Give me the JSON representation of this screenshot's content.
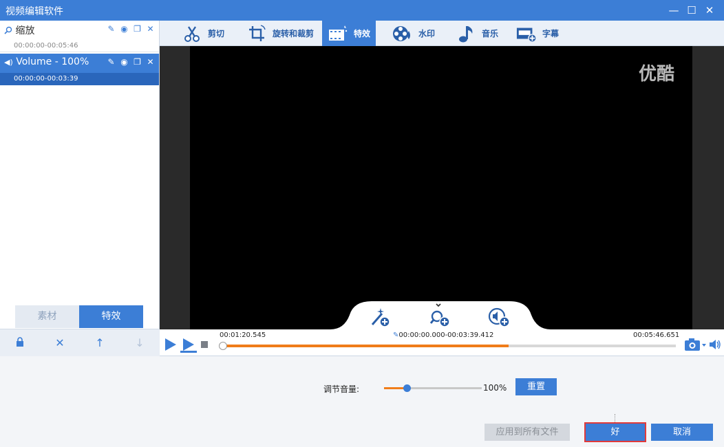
{
  "window": {
    "title": "视频编辑软件",
    "minimize_glyph": "—",
    "maximize_glyph": "☐",
    "close_glyph": "✕"
  },
  "layers": [
    {
      "name": "缩放",
      "time": "00:00:00-00:05:46",
      "selected": false
    },
    {
      "name": "Volume - 100%",
      "time": "00:00:00-00:03:39",
      "selected": true
    }
  ],
  "left_tabs": {
    "material": "素材",
    "effects": "特效",
    "active": "effects"
  },
  "toolbar_tabs": [
    {
      "label": "剪切",
      "icon": "cut-icon"
    },
    {
      "label": "旋转和裁剪",
      "icon": "crop-rotate-icon"
    },
    {
      "label": "特效",
      "icon": "effects-icon",
      "active": true
    },
    {
      "label": "水印",
      "icon": "watermark-icon"
    },
    {
      "label": "音乐",
      "icon": "music-note-icon"
    },
    {
      "label": "字幕",
      "icon": "subtitle-icon"
    }
  ],
  "video": {
    "watermark": "优酷"
  },
  "timeline": {
    "current_time": "00:01:20.545",
    "range": "00:00:00.000-00:03:39.412",
    "total_time": "00:05:46.651",
    "progress_fill": 0.63,
    "handle_pos": 0.0
  },
  "volume": {
    "label": "调节音量:",
    "value_text": "100%",
    "level": 0.23
  },
  "buttons": {
    "reset": "重置",
    "apply_all": "应用到所有文件",
    "ok": "好",
    "cancel": "取消"
  },
  "colors": {
    "accent": "#3c7ed6",
    "progress": "#f07d1a",
    "focus": "#e13a3a"
  }
}
